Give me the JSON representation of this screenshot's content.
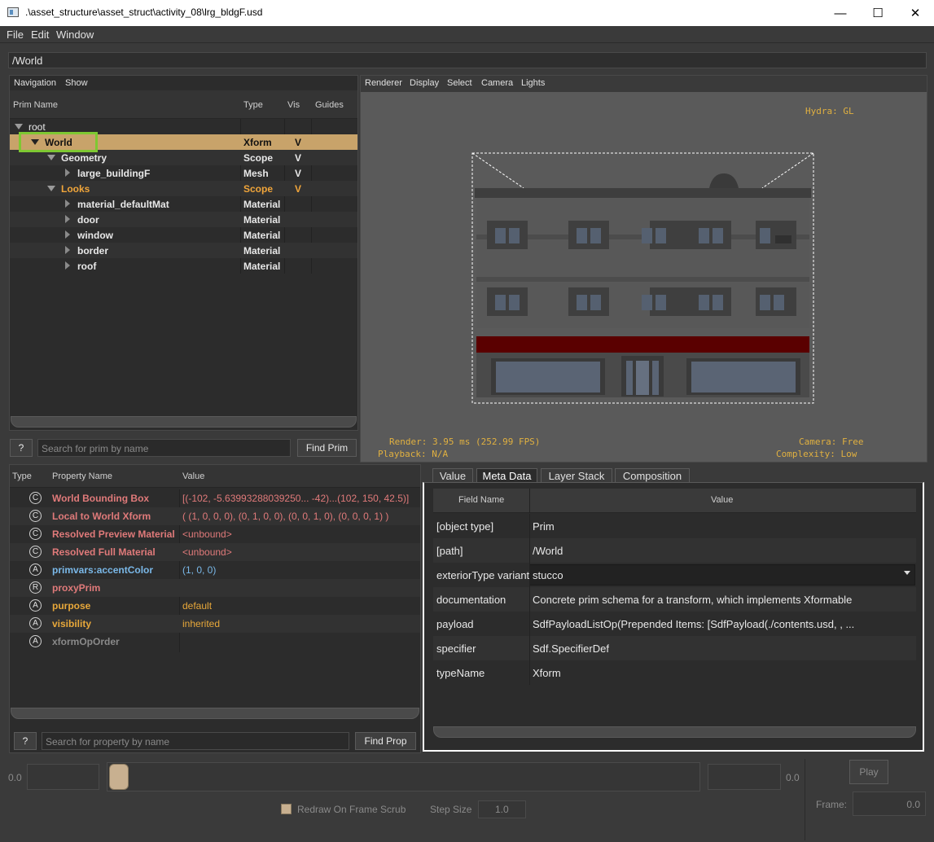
{
  "window": {
    "title": ".\\asset_structure\\asset_struct\\activity_08\\lrg_bldgF.usd",
    "minimize": "—",
    "maximize": "☐",
    "close": "✕"
  },
  "menu": [
    "File",
    "Edit",
    "Window"
  ],
  "path": "/World",
  "prim_panel": {
    "menu": [
      "Navigation",
      "Show"
    ],
    "columns": [
      "Prim Name",
      "Type",
      "Vis",
      "Guides"
    ],
    "rows": [
      {
        "name": "root",
        "type": "",
        "vis": ""
      },
      {
        "name": "World",
        "type": "Xform",
        "vis": "V"
      },
      {
        "name": "Geometry",
        "type": "Scope",
        "vis": "V"
      },
      {
        "name": "large_buildingF",
        "type": "Mesh",
        "vis": "V"
      },
      {
        "name": "Looks",
        "type": "Scope",
        "vis": "V"
      },
      {
        "name": "material_defaultMat",
        "type": "Material",
        "vis": ""
      },
      {
        "name": "door",
        "type": "Material",
        "vis": ""
      },
      {
        "name": "window",
        "type": "Material",
        "vis": ""
      },
      {
        "name": "border",
        "type": "Material",
        "vis": ""
      },
      {
        "name": "roof",
        "type": "Material",
        "vis": ""
      }
    ],
    "help": "?",
    "search_placeholder": "Search for prim by name",
    "find_button": "Find Prim"
  },
  "viewport": {
    "menu": [
      "Renderer",
      "Display",
      "Select",
      "Camera",
      "Lights"
    ],
    "hydra": "Hydra: GL",
    "render": "Render: 3.95 ms (252.99 FPS)",
    "playback": "Playback: N/A",
    "camera": "Camera: Free",
    "complexity": "Complexity: Low"
  },
  "property_panel": {
    "columns": [
      "Type",
      "Property Name",
      "Value"
    ],
    "rows": [
      {
        "icon": "C",
        "name": "World Bounding Box",
        "value": "[(-102, -5.63993288039250... -42)...(102, 150, 42.5)]",
        "color": "#e07a7a"
      },
      {
        "icon": "C",
        "name": "Local to World Xform",
        "value": "( (1, 0, 0, 0), (0, 1, 0, 0), (0, 0, 1, 0), (0, 0, 0, 1) )",
        "color": "#e07a7a"
      },
      {
        "icon": "C",
        "name": "Resolved Preview Material",
        "value": "<unbound>",
        "color": "#e07a7a"
      },
      {
        "icon": "C",
        "name": "Resolved Full Material",
        "value": "<unbound>",
        "color": "#e07a7a"
      },
      {
        "icon": "A",
        "name": "primvars:accentColor",
        "value": "(1, 0, 0)",
        "color": "#7ab8e8"
      },
      {
        "icon": "R",
        "name": "proxyPrim",
        "value": "",
        "color": "#e07a7a"
      },
      {
        "icon": "A",
        "name": "purpose",
        "value": "default",
        "color": "#e8a83a"
      },
      {
        "icon": "A",
        "name": "visibility",
        "value": "inherited",
        "color": "#e8a83a"
      },
      {
        "icon": "A",
        "name": "xformOpOrder",
        "value": "",
        "color": "#8a8a8a"
      }
    ],
    "help": "?",
    "search_placeholder": "Search for property by name",
    "find_button": "Find Prop"
  },
  "meta_panel": {
    "tabs": [
      "Value",
      "Meta Data",
      "Layer Stack",
      "Composition"
    ],
    "columns": [
      "Field Name",
      "Value"
    ],
    "rows": [
      {
        "field": "[object type]",
        "value": "Prim"
      },
      {
        "field": "[path]",
        "value": "/World"
      },
      {
        "field": "exteriorType variant",
        "value": "stucco"
      },
      {
        "field": "documentation",
        "value": "Concrete prim schema for a transform, which implements Xformable"
      },
      {
        "field": "payload",
        "value": "SdfPayloadListOp(Prepended Items: [SdfPayload(./contents.usd, , ..."
      },
      {
        "field": "specifier",
        "value": "Sdf.SpecifierDef"
      },
      {
        "field": "typeName",
        "value": "Xform"
      }
    ]
  },
  "timeline": {
    "start": "0.0",
    "end": "0.0",
    "redraw_label": "Redraw On Frame Scrub",
    "step_label": "Step Size",
    "step_value": "1.0",
    "play": "Play",
    "frame_label": "Frame:",
    "frame_value": "0.0"
  },
  "colors": {
    "selection": "#c8a36a",
    "highlight_box": "#7ec832",
    "accent_orange": "#f0a53a",
    "hud": "#e0b040",
    "band": "#5a0000"
  }
}
